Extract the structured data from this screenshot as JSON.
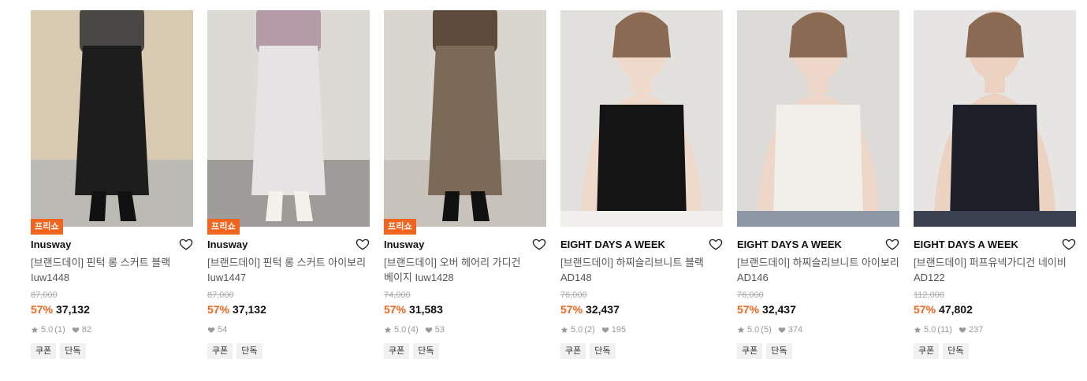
{
  "products": [
    {
      "badge": "프리쇼",
      "brand": "Inusway",
      "name": "[브랜드데이] 핀턱 롱 스커트 블랙 Iuw1448",
      "original_price": "87,000",
      "discount": "57%",
      "price": "37,132",
      "rating": "5.0",
      "reviews": "(1)",
      "likes": "82",
      "tags": [
        "쿠폰",
        "단독"
      ],
      "image": {
        "bg": "#d8c9b1",
        "figure": "#1d1d1d",
        "accent": "#4a4845",
        "floor": "#bcbab4"
      }
    },
    {
      "badge": "프리쇼",
      "brand": "Inusway",
      "name": "[브랜드데이] 핀턱 롱 스커트 아이보리 Iuw1447",
      "original_price": "87,000",
      "discount": "57%",
      "price": "37,132",
      "rating": "",
      "reviews": "",
      "likes": "54",
      "tags": [
        "쿠폰",
        "단독"
      ],
      "image": {
        "bg": "#dcdad5",
        "figure": "#e7e3e4",
        "accent": "#b59aa8",
        "floor": "#9d9c99"
      }
    },
    {
      "badge": "프리쇼",
      "brand": "Inusway",
      "name": "[브랜드데이] 오버 헤어리 가디건 베이지 Iuw1428",
      "original_price": "74,000",
      "discount": "57%",
      "price": "31,583",
      "rating": "5.0",
      "reviews": "(4)",
      "likes": "53",
      "tags": [
        "쿠폰",
        "단독"
      ],
      "image": {
        "bg": "#d9d6d0",
        "figure": "#7b6a58",
        "accent": "#5c4b3b",
        "floor": "#c7c2ba"
      }
    },
    {
      "badge": "",
      "brand": "EIGHT DAYS A WEEK",
      "name": "[브랜드데이] 하찌슬리브니트 블랙 AD148",
      "original_price": "76,000",
      "discount": "57%",
      "price": "32,437",
      "rating": "5.0",
      "reviews": "(2)",
      "likes": "195",
      "tags": [
        "쿠폰",
        "단독"
      ],
      "image": {
        "bg": "#e3e1de",
        "figure": "#141414",
        "accent": "#efd9cb",
        "floor": "#f2f0ed"
      }
    },
    {
      "badge": "",
      "brand": "EIGHT DAYS A WEEK",
      "name": "[브랜드데이] 하찌슬리브니트 아이보리 AD146",
      "original_price": "76,000",
      "discount": "57%",
      "price": "32,437",
      "rating": "5.0",
      "reviews": "(5)",
      "likes": "374",
      "tags": [
        "쿠폰",
        "단독"
      ],
      "image": {
        "bg": "#dddbd8",
        "figure": "#f1efe9",
        "accent": "#eed7c8",
        "floor": "#8d97a5"
      }
    },
    {
      "badge": "",
      "brand": "EIGHT DAYS A WEEK",
      "name": "[브랜드데이] 퍼프유넥가디건 네이비 AD122",
      "original_price": "112,000",
      "discount": "57%",
      "price": "47,802",
      "rating": "5.0",
      "reviews": "(11)",
      "likes": "237",
      "tags": [
        "쿠폰",
        "단독"
      ],
      "image": {
        "bg": "#e6e5e3",
        "figure": "#1c1f28",
        "accent": "#ecd2c1",
        "floor": "#3a4150"
      }
    }
  ],
  "icons": {
    "wishlist": "heart-outline-icon",
    "rating": "star-icon",
    "likes": "heart-filled-icon"
  },
  "colors": {
    "accent": "#f3641e",
    "badge_text": "#ffffff",
    "muted": "#999999",
    "tag_bg": "#f1f1f1"
  }
}
